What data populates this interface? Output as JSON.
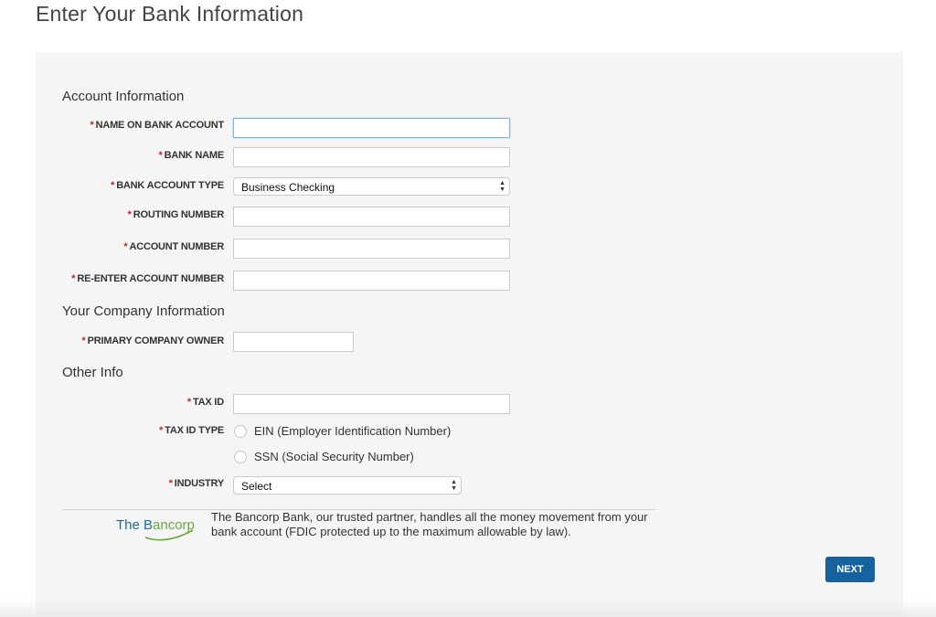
{
  "page_title": "Enter Your Bank Information",
  "sections": {
    "account": "Account Information",
    "company": "Your Company Information",
    "other": "Other Info"
  },
  "required_marker": "*",
  "fields": {
    "name_on_account": {
      "label": "NAME ON BANK ACCOUNT",
      "value": ""
    },
    "bank_name": {
      "label": "BANK NAME",
      "value": ""
    },
    "account_type": {
      "label": "BANK ACCOUNT TYPE",
      "selected": "Business Checking"
    },
    "routing_number": {
      "label": "ROUTING NUMBER",
      "value": ""
    },
    "account_number": {
      "label": "ACCOUNT NUMBER",
      "value": ""
    },
    "reenter_account": {
      "label": "RE-ENTER ACCOUNT NUMBER",
      "value": ""
    },
    "primary_owner": {
      "label": "PRIMARY COMPANY OWNER",
      "value": ""
    },
    "tax_id": {
      "label": "TAX ID",
      "value": ""
    },
    "tax_id_type": {
      "label": "TAX ID TYPE",
      "options": [
        "EIN (Employer Identification Number)",
        "SSN (Social Security Number)"
      ]
    },
    "industry": {
      "label": "INDUSTRY",
      "selected": "Select"
    }
  },
  "partner": {
    "logo_part1": "The B",
    "logo_part2": "ancorp",
    "text": "The Bancorp Bank, our trusted partner, handles all the money movement from your bank account (FDIC protected up to the maximum allowable by law)."
  },
  "next_label": "NEXT",
  "colors": {
    "panel_bg": "#f5f5f5",
    "required": "#cc2222",
    "button_bg": "#14629e",
    "focus_border": "#7fb6e6",
    "logo_blue": "#1d6aa8",
    "logo_green": "#6aa83a"
  },
  "icons": {
    "select_arrows": "select-arrows-icon"
  }
}
